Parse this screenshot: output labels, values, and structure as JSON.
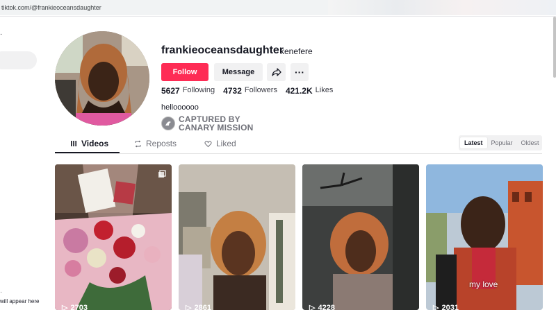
{
  "browser": {
    "url": "tiktok.com/@frankieoceansdaughter"
  },
  "sidebar": {
    "hint": "will appear here"
  },
  "profile": {
    "username": "frankieoceansdaughter",
    "nickname": "kenefere",
    "follow_label": "Follow",
    "message_label": "Message",
    "following_count": "5627",
    "following_label": "Following",
    "followers_count": "4732",
    "followers_label": "Followers",
    "likes_count": "421.2K",
    "likes_label": "Likes",
    "bio": "helloooooo",
    "watermark_line1": "CAPTURED BY",
    "watermark_line2": "CANARY MISSION"
  },
  "tabs": [
    {
      "label": "Videos",
      "icon": "grid-lines-icon",
      "active": true
    },
    {
      "label": "Reposts",
      "icon": "repost-icon",
      "active": false
    },
    {
      "label": "Liked",
      "icon": "heart-outline-icon",
      "active": false
    }
  ],
  "sort": {
    "options": [
      "Latest",
      "Popular",
      "Oldest"
    ],
    "selected": "Latest"
  },
  "videos": [
    {
      "views": "2703",
      "caption": "",
      "multi_image": true
    },
    {
      "views": "2861",
      "caption": "",
      "multi_image": false
    },
    {
      "views": "4228",
      "caption": "",
      "multi_image": false
    },
    {
      "views": "2031",
      "caption": "my love",
      "multi_image": false
    }
  ],
  "colors": {
    "accent": "#fe2c55",
    "text": "#161823",
    "muted": "#6f7078"
  }
}
